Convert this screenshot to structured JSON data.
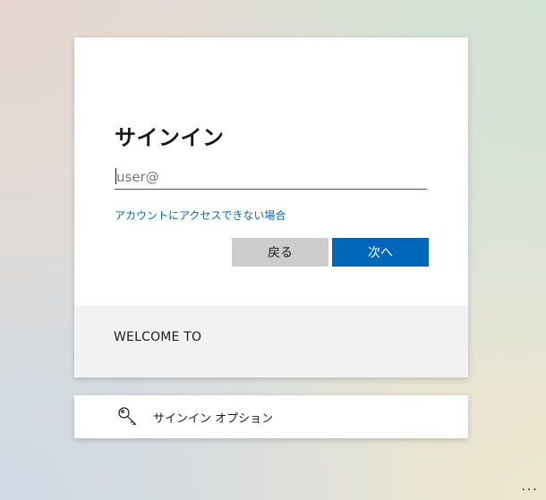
{
  "signin": {
    "title": "サインイン",
    "email_placeholder": "user@",
    "email_value": "",
    "help_link": "アカウントにアクセスできない場合",
    "back_label": "戻る",
    "next_label": "次へ"
  },
  "footer": {
    "welcome_text": "WELCOME TO"
  },
  "options": {
    "icon": "key-icon",
    "label": "サインイン オプション"
  },
  "more": {
    "label": "..."
  },
  "colors": {
    "accent": "#0067b8",
    "back_button": "#cccccc",
    "footer_bg": "#f2f2f2",
    "text": "#1b1b1b"
  }
}
